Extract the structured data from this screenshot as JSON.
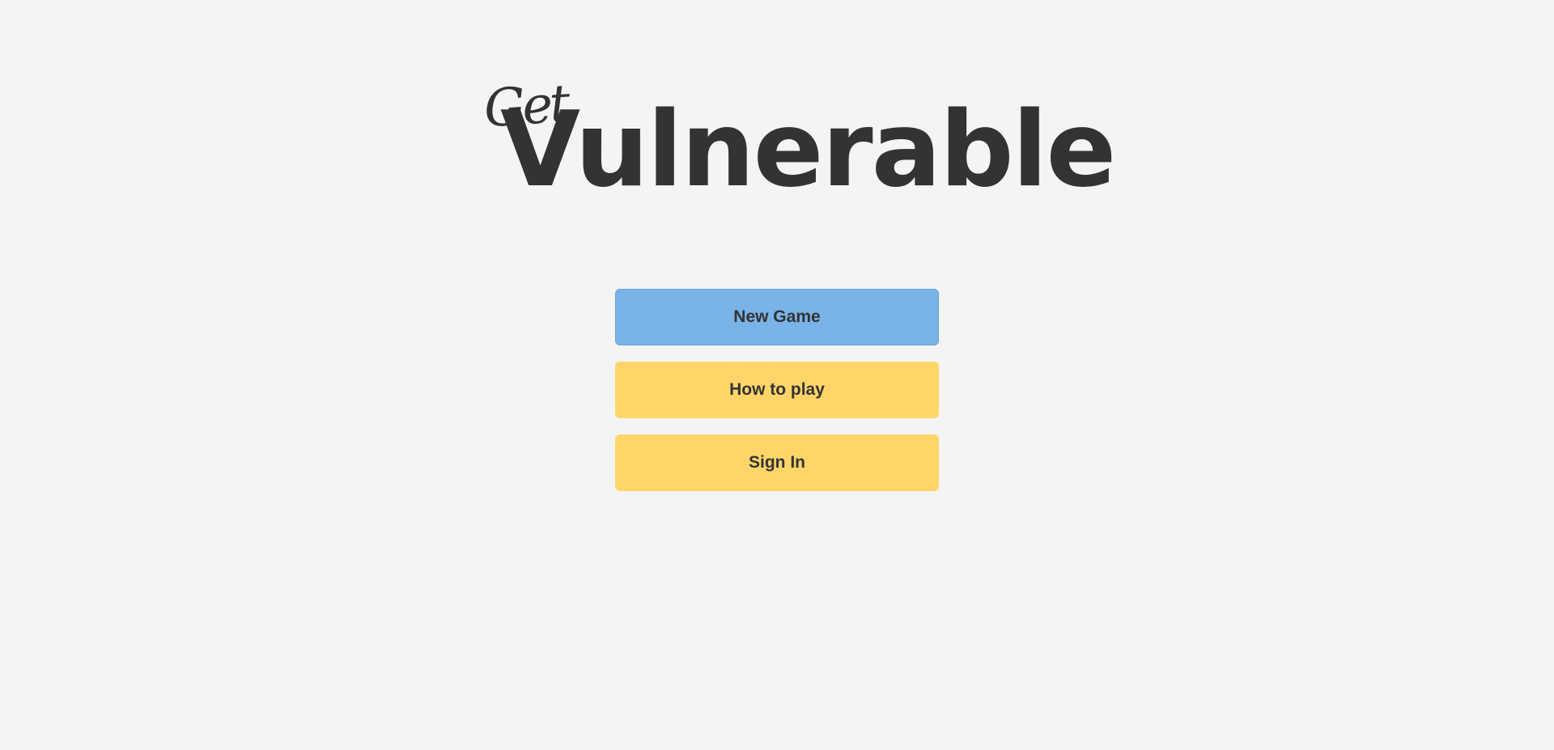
{
  "logo": {
    "script_text": "Get",
    "main_text": "Vulnerable"
  },
  "menu": {
    "new_game_label": "New Game",
    "how_to_play_label": "How to play",
    "sign_in_label": "Sign In"
  },
  "colors": {
    "background": "#f4f4f4",
    "text": "#333333",
    "primary_button": "#7ab3e8",
    "secondary_button": "#ffd56a"
  }
}
